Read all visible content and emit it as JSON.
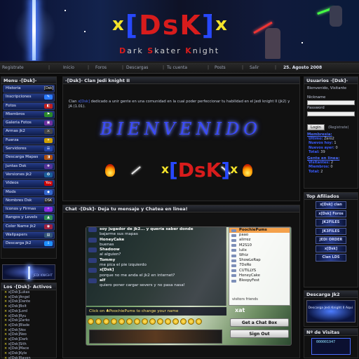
{
  "banner": {
    "logo_open": "[",
    "logo_dsk_d": "D",
    "logo_dsk_s": "s",
    "logo_dsk_k": "K",
    "logo_close": "]",
    "logo_x": "x",
    "subtitle_d": "D",
    "subtitle_ark": "ark ",
    "subtitle_s": "S",
    "subtitle_kater": "kater ",
    "subtitle_k": "K",
    "subtitle_night": "night"
  },
  "nav": {
    "items": [
      "Inicio",
      "Foros",
      "Descargas",
      "Tu cuenta",
      "Posts",
      "Salir"
    ],
    "left": "Registrate",
    "date": "25. Agosto 2008"
  },
  "menu": {
    "title": "Menu -[Dsk]-",
    "items": [
      {
        "label": "Historia",
        "icon": "[Dsk]"
      },
      {
        "label": "Inscripciones",
        "icon": "✎"
      },
      {
        "label": "Fotos",
        "icon": "◧"
      },
      {
        "label": "Miembros",
        "icon": "⚑"
      },
      {
        "label": "Galeria Fotos",
        "icon": "▣"
      },
      {
        "label": "Armas jk2",
        "icon": "⚔"
      },
      {
        "label": "Fuerza",
        "icon": "✦"
      },
      {
        "label": "Servidores",
        "icon": "☰"
      },
      {
        "label": "Descarga Mapas",
        "icon": "◨"
      },
      {
        "label": "Juntas Dsk",
        "icon": "❖"
      },
      {
        "label": "Versiones jk2",
        "icon": "✪"
      },
      {
        "label": "Videos",
        "icon": "You"
      },
      {
        "label": "Mods",
        "icon": "◆"
      },
      {
        "label": "Nombres Dsk",
        "icon": "DSK"
      },
      {
        "label": "Iconos y Firmas",
        "icon": "✧"
      },
      {
        "label": "Rangos y Levels",
        "icon": "▲"
      },
      {
        "label": "Color Name jk2",
        "icon": "◉"
      },
      {
        "label": "Wallpapers",
        "icon": "▤"
      },
      {
        "label": "Descarga Jk2",
        "icon": "⇩"
      }
    ],
    "jk_logo": "JEDI KNIGHT"
  },
  "active": {
    "title": "Los -[Dsk]- Activos",
    "members": [
      "x[Dsk]Lukas",
      "x[Dsk]Angel",
      "x[Dsk]Dante",
      "x[Dsk]Bolt",
      "x[Dsk]Lord",
      "x[Dsk]Ryu",
      "x[Dsk]Zarko",
      "x[Dsk]Blade",
      "x[Dsk]Vex",
      "x[Dsk]Neo",
      "x[Dsk]Dark",
      "x[Dsk]Sith",
      "x[Dsk]Mace",
      "x[Dsk]Kyle",
      "x[Dsk]Raven"
    ]
  },
  "welcome": {
    "title": "-[Dsk]- Clan Jedi knight II",
    "text_prefix": "Clan ",
    "text_clan": "x[Dsk]",
    "text_body": " dedicado a unir gente en una comunidad en la cual poder perfeccionar tu habilidad en el Jedi knight II (jk2) y JA (1.01).",
    "bienvenido": "BIENVENIDO",
    "dsk_open": "[",
    "dsk_d": "D",
    "dsk_s": "s",
    "dsk_k": "K",
    "dsk_close": "]",
    "dsk_x": "x"
  },
  "chat": {
    "title": "Chat -[Dsk]- Deja tu mensaje y Chatea en linea!",
    "messages": [
      {
        "text": "soy jugador de jk2... y quería saber donde",
        "name": true
      },
      {
        "text": "bajarme sus mapas",
        "name": false
      },
      {
        "text": "HoneyCake",
        "name": true
      },
      {
        "text": "buenas",
        "name": false
      },
      {
        "text": "Shadoow",
        "name": true
      },
      {
        "text": "al alguien?",
        "name": false
      },
      {
        "text": "Tommy",
        "name": true
      },
      {
        "text": "me pica el pie izquierdo",
        "name": false
      },
      {
        "text": "x[Dsk]",
        "name": true
      },
      {
        "text": "porque no me anda el jk2 en internet?",
        "name": false
      },
      {
        "text": "alf",
        "name": true
      },
      {
        "text": "quiero poner cargar severs y no pasa nasa!",
        "name": false
      }
    ],
    "command": "Click on ♣PoochiePums to change your name",
    "users": [
      "PoochiePums",
      "paao",
      "alirrez",
      "M2S10",
      "lulix",
      "Whiz",
      "ShowLeRap",
      "7DeRo",
      "CUTILLYS",
      "HoneyCake",
      "BleepyFest"
    ],
    "users_label": "visitors     friends",
    "xat": "xat",
    "get_box": "Get a Chat Box",
    "sign_out": "Sign Out"
  },
  "users_panel": {
    "title": "Usuarios -[Dsk]-",
    "welcome": "Bienvenido, Visitante",
    "nickname_label": "Nickname",
    "password_label": "Password",
    "login_btn": "Login",
    "register": "(Registrate)",
    "members_hd": "Membresia:",
    "stats": [
      {
        "label": "Ultimo:",
        "value": "Zero2"
      },
      {
        "label": "Nuevos hoy:",
        "value": "1"
      },
      {
        "label": "Nuevos ayer:",
        "value": "0"
      },
      {
        "label": "Total:",
        "value": "39"
      }
    ],
    "online_hd": "Gente en linea:",
    "online": [
      {
        "label": "Visitantes:",
        "value": "2"
      },
      {
        "label": "Miembros:",
        "value": "0"
      },
      {
        "label": "Total:",
        "value": "2"
      }
    ]
  },
  "affiliates": {
    "title": "Top Afiliados",
    "items": [
      "x[Dsk] clan",
      "x[Dsk] Foros",
      "JK2FILES",
      "JK3FILES",
      "JEDI ORDER",
      "x[Dsk]",
      "Clan LDS"
    ]
  },
  "download": {
    "title": "Descarga Jk2",
    "caption": "Descarga Jedi Knight II Aqui"
  },
  "visits": {
    "title": "Nº de Visitas",
    "counter": "000001947"
  }
}
